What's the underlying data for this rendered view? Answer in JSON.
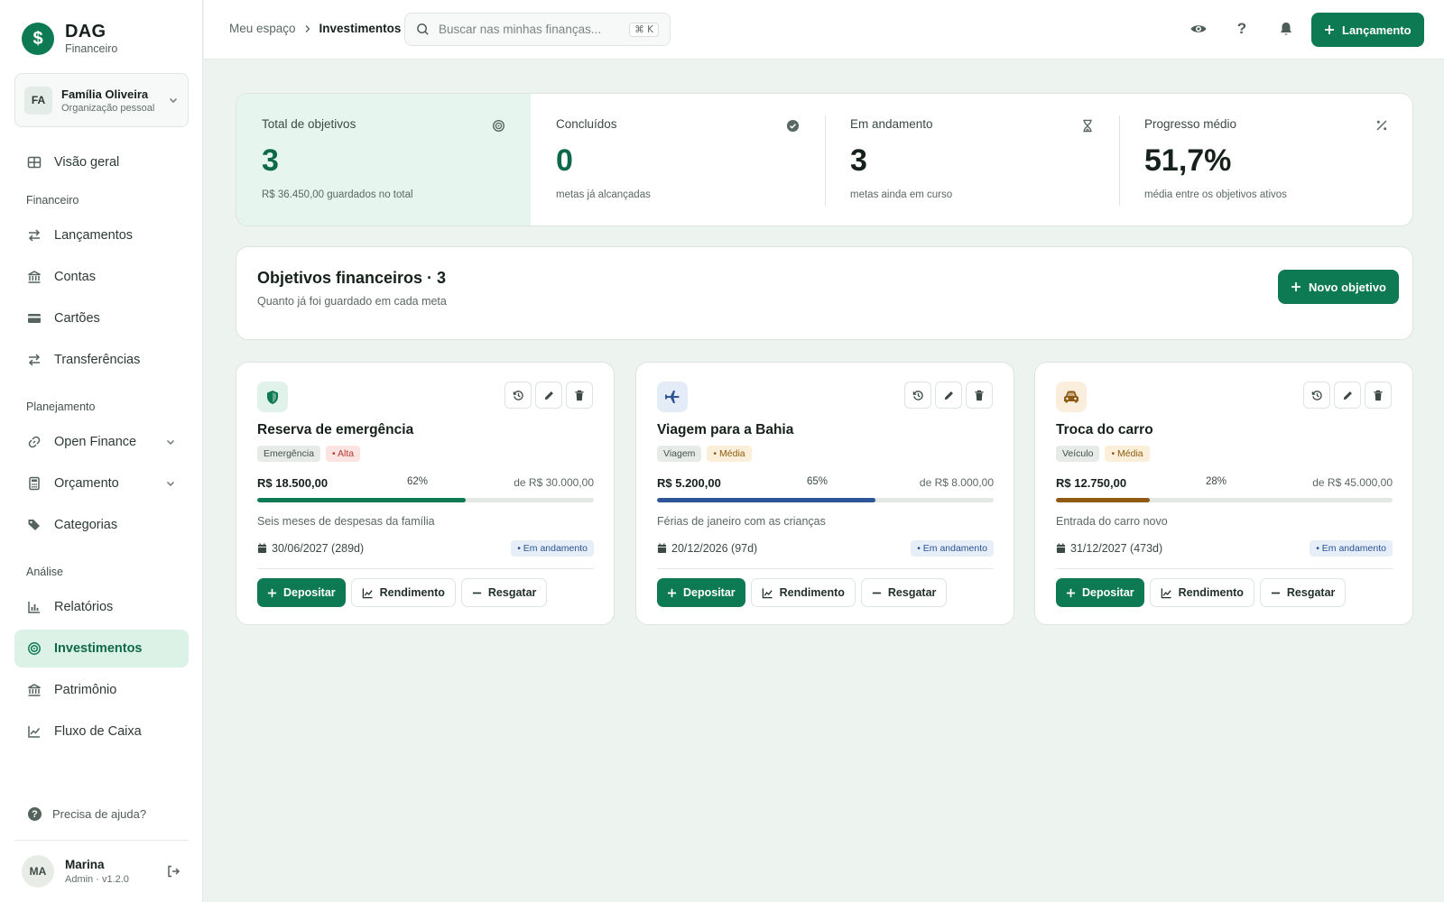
{
  "brand": {
    "name": "DAG",
    "sub": "Financeiro",
    "logo": "$"
  },
  "org": {
    "initials": "FA",
    "name": "Família Oliveira",
    "sub": "Organização pessoal"
  },
  "nav": {
    "overview": "Visão geral",
    "section_fin": "Financeiro",
    "launches": "Lançamentos",
    "accounts": "Contas",
    "cards": "Cartões",
    "transfers": "Transferências",
    "section_plan": "Planejamento",
    "open_finance": "Open Finance",
    "budget": "Orçamento",
    "categories": "Categorias",
    "section_analysis": "Análise",
    "reports": "Relatórios",
    "investments": "Investimentos",
    "assets": "Patrimônio",
    "cashflow": "Fluxo de Caixa"
  },
  "help": "Precisa de ajuda?",
  "user": {
    "initials": "MA",
    "name": "Marina",
    "sub": "Admin · v1.2.0"
  },
  "topbar": {
    "crumb_root": "Meu espaço",
    "crumb_current": "Investimentos",
    "search_placeholder": "Buscar nas minhas finanças...",
    "search_kbd": "⌘ K",
    "launch_label": "Lançamento"
  },
  "stats": [
    {
      "label": "Total de objetivos",
      "value": "3",
      "sub": "R$ 36.450,00 guardados no total"
    },
    {
      "label": "Concluídos",
      "value": "0",
      "sub": "metas já alcançadas"
    },
    {
      "label": "Em andamento",
      "value": "3",
      "sub": "metas ainda em curso"
    },
    {
      "label": "Progresso médio",
      "value": "51,7%",
      "sub": "média entre os objetivos ativos"
    }
  ],
  "section": {
    "title": "Objetivos financeiros · 3",
    "subtitle": "Quanto já foi guardado em cada meta",
    "new_goal_label": "Novo objetivo"
  },
  "goals": [
    {
      "title": "Reserva de emergência",
      "category": "Emergência",
      "priority": "Alta",
      "current": "R$ 18.500,00",
      "percent": "62%",
      "progress": 0.62,
      "target": "de R$ 30.000,00",
      "description": "Seis meses de despesas da família",
      "deadline": "30/06/2027 (289d)",
      "status": "Em andamento",
      "icon": "shield-icon",
      "bar_color": "#0e7a54",
      "icon_bg": "#e0f2e9",
      "icon_color": "#0e7a54"
    },
    {
      "title": "Viagem para a Bahia",
      "category": "Viagem",
      "priority": "Média",
      "current": "R$ 5.200,00",
      "percent": "65%",
      "progress": 0.65,
      "target": "de R$ 8.000,00",
      "description": "Férias de janeiro com as crianças",
      "deadline": "20/12/2026 (97d)",
      "status": "Em andamento",
      "icon": "airplane-icon",
      "bar_color": "#2e5597",
      "icon_bg": "#e4ecf8",
      "icon_color": "#2e5597"
    },
    {
      "title": "Troca do carro",
      "category": "Veículo",
      "priority": "Média",
      "current": "R$ 12.750,00",
      "percent": "28%",
      "progress": 0.28,
      "target": "de R$ 45.000,00",
      "description": "Entrada do carro novo",
      "deadline": "31/12/2027 (473d)",
      "status": "Em andamento",
      "icon": "car-icon",
      "bar_color": "#8f5a12",
      "icon_bg": "#fbeedd",
      "icon_color": "#8f5a12"
    }
  ],
  "goal_actions": {
    "deposit": "Depositar",
    "yield": "Rendimento",
    "withdraw": "Resgatar"
  }
}
